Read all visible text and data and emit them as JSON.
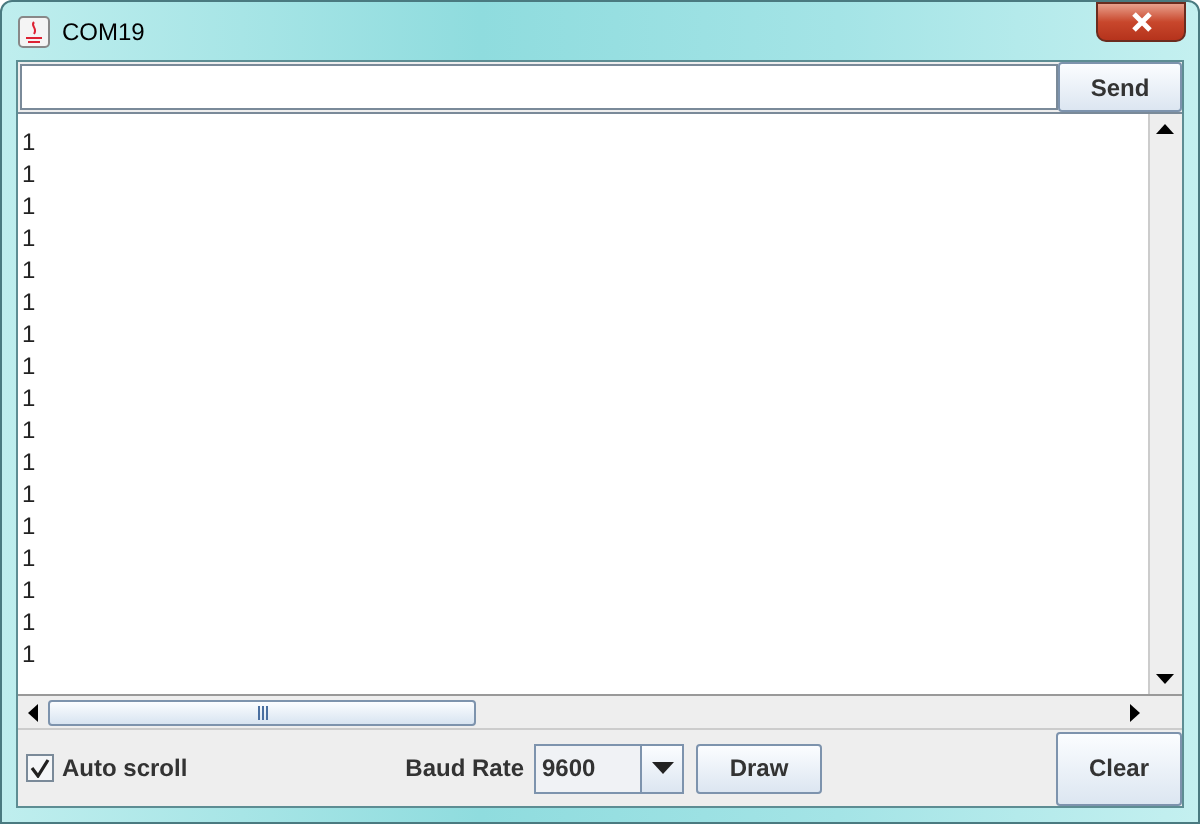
{
  "window": {
    "title": "COM19"
  },
  "send_button": "Send",
  "output_lines": [
    "1",
    "1",
    "1",
    "1",
    "1",
    "1",
    "1",
    "1",
    "1",
    "1",
    "1",
    "1",
    "1",
    "1",
    "1",
    "1",
    "1"
  ],
  "auto_scroll": {
    "label": "Auto scroll",
    "checked": true
  },
  "baud_rate": {
    "label": "Baud Rate",
    "value": "9600"
  },
  "draw_button": "Draw",
  "clear_button": "Clear"
}
